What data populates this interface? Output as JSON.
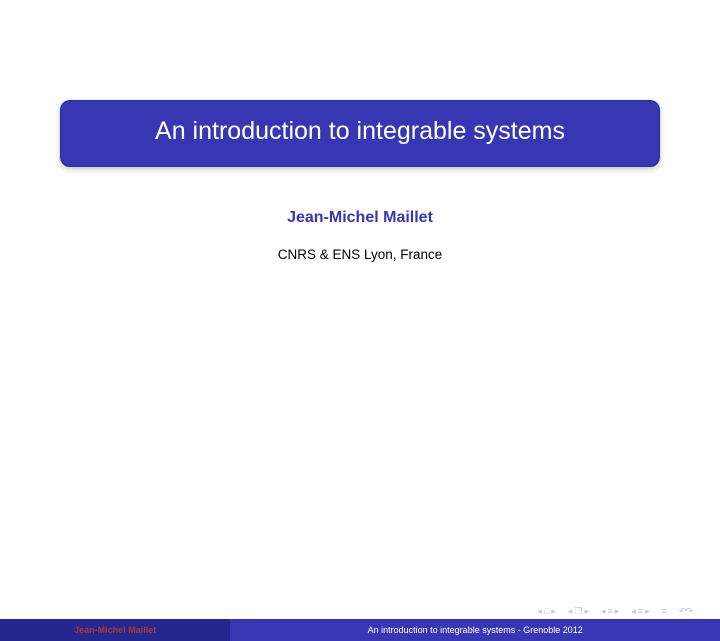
{
  "title": "An introduction to integrable systems",
  "author": "Jean-Michel Maillet",
  "affiliation": "CNRS & ENS Lyon, France",
  "footer": {
    "author_short": "Jean-Michel Maillet",
    "title_event": "An introduction to integrable systems - Grenoble 2012"
  },
  "nav": {
    "frame_back": "◂",
    "frame_fwd": "▸",
    "frame_sym": "□",
    "sub_back": "◂",
    "sub_fwd": "▸",
    "sub_sym": "❐",
    "sec_back1": "◂",
    "sec_fwd1": "▸",
    "sec_sym1": "≡",
    "sec_back2": "◂",
    "sec_fwd2": "▸",
    "sec_sym2": "≡",
    "goto": "≡",
    "undo": "↶↷"
  }
}
